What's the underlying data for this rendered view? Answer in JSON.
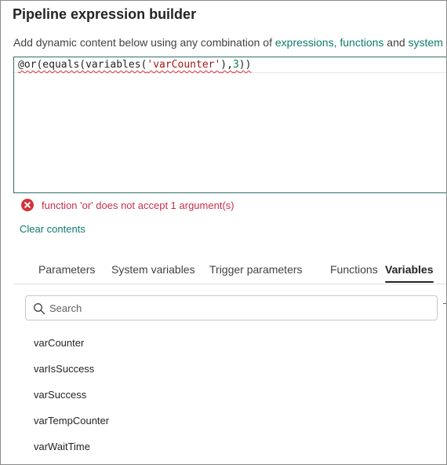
{
  "dialog": {
    "title": "Pipeline expression builder",
    "description": {
      "prefix": "Add dynamic content below using any combination of ",
      "link_expressions": "expressions,",
      "link_functions": "functions",
      "conjunction": " and ",
      "link_system_variables": "system variable"
    }
  },
  "editor": {
    "expression": {
      "part1": "@or(equals(variables(",
      "string": "'varCounter'",
      "part2": "),",
      "number": "3",
      "part3": "))"
    }
  },
  "error": {
    "icon": "error-circle-icon",
    "message": "function 'or' does not accept 1 argument(s)"
  },
  "clear_contents_label": "Clear contents",
  "tabs": [
    {
      "label": "Parameters",
      "active": false
    },
    {
      "label": "System variables",
      "active": false
    },
    {
      "label": "Trigger parameters",
      "active": false
    },
    {
      "label": "Functions",
      "active": false
    },
    {
      "label": "Variables",
      "active": true
    }
  ],
  "search": {
    "placeholder": "Search",
    "value": "",
    "icon": "search-icon"
  },
  "variables": [
    {
      "name": "varCounter"
    },
    {
      "name": "varIsSuccess"
    },
    {
      "name": "varSuccess"
    },
    {
      "name": "varTempCounter"
    },
    {
      "name": "varWaitTime"
    }
  ],
  "colors": {
    "accent_link": "#0e7a6f",
    "error": "#d13438",
    "editor_border": "#2f6f68"
  }
}
